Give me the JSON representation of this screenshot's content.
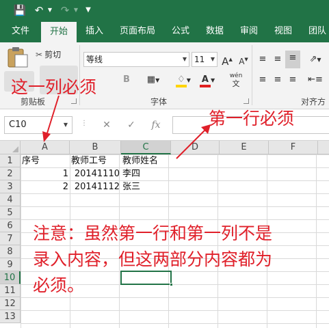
{
  "qat": {
    "save_icon": "save-icon",
    "undo_icon": "undo-icon",
    "redo_icon": "redo-icon",
    "customize_icon": "customize-icon"
  },
  "tabs": [
    "文件",
    "开始",
    "插入",
    "页面布局",
    "公式",
    "数据",
    "审阅",
    "视图",
    "团队"
  ],
  "ribbon": {
    "cut_label": "剪切",
    "font_name": "等线",
    "font_size": "11",
    "grow_font": "A",
    "shrink_font": "A",
    "bold": "B",
    "font_color_letter": "A",
    "phonetic": "wén",
    "group_clipboard": "剪贴板",
    "group_font": "字体",
    "group_align": "对齐方"
  },
  "formula_bar": {
    "name_box": "C10",
    "fx_label": "fx",
    "value": ""
  },
  "grid": {
    "columns": [
      "A",
      "B",
      "C",
      "D",
      "E",
      "F"
    ],
    "rows": [
      "1",
      "2",
      "3",
      "4",
      "5",
      "6",
      "7",
      "8",
      "9",
      "10",
      "11",
      "12",
      "13"
    ],
    "active_cell": "C10",
    "cells": {
      "A1": "序号",
      "B1": "教师工号",
      "C1": "教师姓名",
      "A2": "1",
      "B2": "20141110",
      "C2": "李四",
      "A3": "2",
      "B3": "20141112",
      "C3": "张三"
    }
  },
  "annotations": {
    "column_note": "这一列必须",
    "row_note": "第一行必须",
    "note_line1": "注意：虽然第一行和第一列不是",
    "note_line2": "录入内容，但这两部分内容都为",
    "note_line3": "必须。"
  },
  "colors": {
    "excel_green": "#217346",
    "annotation_red": "#e0202a"
  }
}
